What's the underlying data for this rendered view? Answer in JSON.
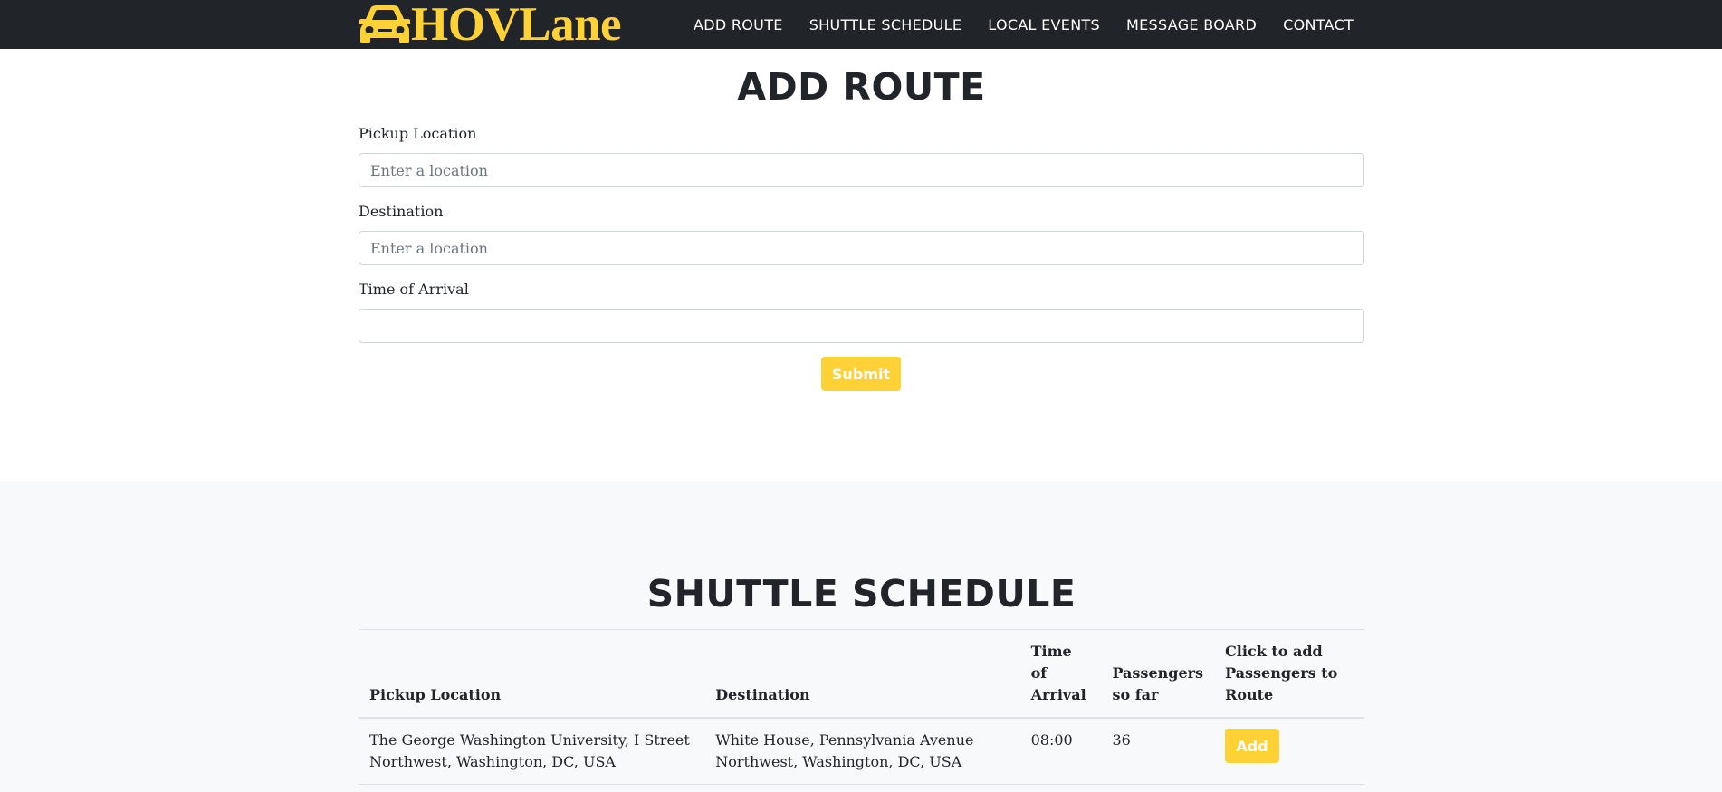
{
  "brand": {
    "name": "HOVLane",
    "icon": "car-icon",
    "color": "#fed136"
  },
  "nav": {
    "items": [
      {
        "label": "ADD ROUTE"
      },
      {
        "label": "SHUTTLE SCHEDULE"
      },
      {
        "label": "LOCAL EVENTS"
      },
      {
        "label": "MESSAGE BOARD"
      },
      {
        "label": "CONTACT"
      }
    ]
  },
  "add_route": {
    "title": "ADD ROUTE",
    "pickup_label": "Pickup Location",
    "pickup_placeholder": "Enter a location",
    "pickup_value": "",
    "destination_label": "Destination",
    "destination_placeholder": "Enter a location",
    "destination_value": "",
    "arrival_label": "Time of Arrival",
    "arrival_value": "",
    "submit_label": "Submit"
  },
  "schedule": {
    "title": "SHUTTLE SCHEDULE",
    "columns": [
      "Pickup Location",
      "Destination",
      "Time of Arrival",
      "Passengers so far",
      "Click to add Passengers to Route"
    ],
    "rows": [
      {
        "pickup": "The George Washington University, I Street Northwest, Washington, DC, USA",
        "destination": "White House, Pennsylvania Avenue Northwest, Washington, DC, USA",
        "arrival": "08:00",
        "passengers": "36",
        "action_label": "Add"
      }
    ]
  },
  "colors": {
    "navbar": "#212529",
    "accent": "#fed136",
    "section_bg": "#f8f9fa"
  }
}
